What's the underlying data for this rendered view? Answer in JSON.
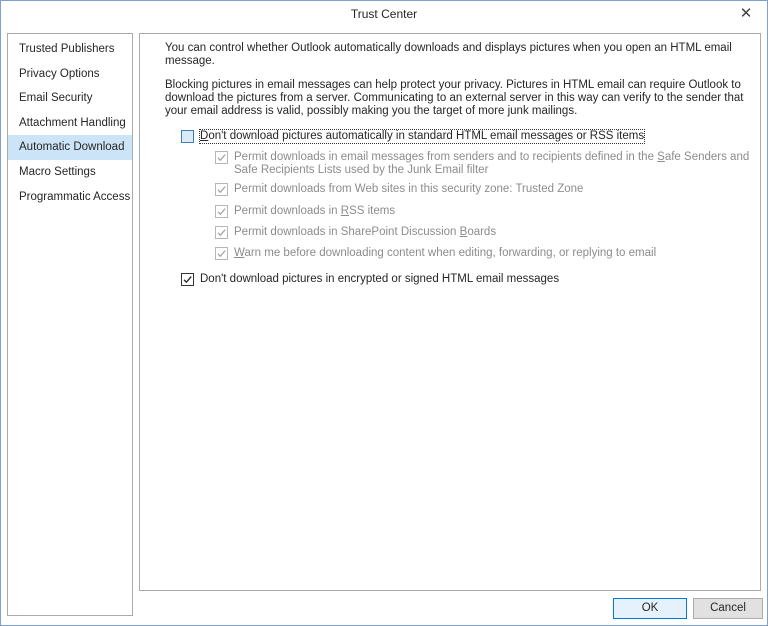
{
  "window": {
    "title": "Trust Center",
    "close_glyph": "✕"
  },
  "sidebar": {
    "items": [
      {
        "label": "Trusted Publishers",
        "selected": false
      },
      {
        "label": "Privacy Options",
        "selected": false
      },
      {
        "label": "Email Security",
        "selected": false
      },
      {
        "label": "Attachment Handling",
        "selected": false
      },
      {
        "label": "Automatic Download",
        "selected": true
      },
      {
        "label": "Macro Settings",
        "selected": false
      },
      {
        "label": "Programmatic Access",
        "selected": false
      }
    ]
  },
  "content": {
    "para1": "You can control whether Outlook automatically downloads and displays pictures when you open an HTML email message.",
    "para2": "Blocking pictures in email messages can help protect your privacy. Pictures in HTML email can require Outlook to download the pictures from a server. Communicating to an external server in this way can verify to the sender that your email address is valid, possibly making you the target of more junk mailings.",
    "options": {
      "main": {
        "pre": "",
        "key": "D",
        "post": "on't download pictures automatically in standard HTML email messages or RSS items",
        "checked": false
      },
      "safe_senders": {
        "pre": "Permit downloads in email messages from senders and to recipients defined in the ",
        "key": "S",
        "post": "afe Senders and Safe Recipients Lists used by the Junk Email filter",
        "checked": true,
        "disabled": true
      },
      "web_sites": {
        "pre": "Permit downloads from Web sites in this security zone: Trusted Zone",
        "key": "",
        "post": "",
        "checked": true,
        "disabled": true
      },
      "rss": {
        "pre": "Permit downloads in ",
        "key": "R",
        "post": "SS items",
        "checked": true,
        "disabled": true
      },
      "sharepoint": {
        "pre": "Permit downloads in SharePoint Discussion ",
        "key": "B",
        "post": "oards",
        "checked": true,
        "disabled": true
      },
      "warn": {
        "pre": "",
        "key": "W",
        "post": "arn me before downloading content when editing, forwarding, or replying to email",
        "checked": true,
        "disabled": true
      },
      "encrypted": {
        "pre": "Don't download pictures in encrypted or signed HTML email messages",
        "key": "",
        "post": "",
        "checked": true,
        "disabled": false
      }
    }
  },
  "buttons": {
    "ok": "OK",
    "cancel": "Cancel"
  },
  "icons": {
    "close": "close-icon",
    "check": "checkmark-icon"
  },
  "colors": {
    "selected_item": "#cce4f7",
    "window_border": "#7da2ce",
    "focus_button_border": "#0078d7"
  }
}
